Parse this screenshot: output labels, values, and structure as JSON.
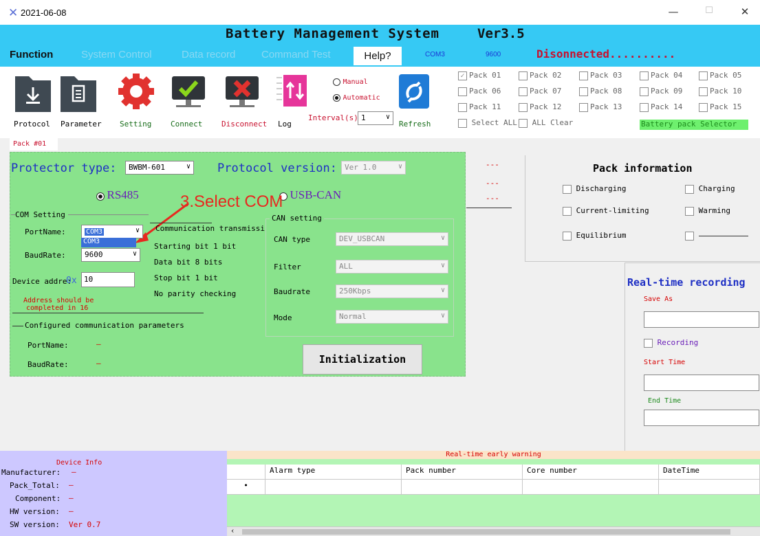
{
  "window": {
    "title": "2021-06-08",
    "minimize": "—",
    "maximize": "☐",
    "close": "✕"
  },
  "header": {
    "title": "Battery Management System",
    "version": "Ver3.5"
  },
  "menu": {
    "items": [
      "Function",
      "System Control",
      "Data record",
      "Command Test",
      "Help?"
    ],
    "com": "COM3",
    "baud": "9600",
    "connection": "Disonnected.........."
  },
  "toolbar": {
    "tools": [
      "Protocol",
      "Parameter",
      "Setting",
      "Connect",
      "Disconnect",
      "Log"
    ],
    "mode_manual": "Manual",
    "mode_automatic": "Automatic",
    "interval_label": "Interval(s)",
    "interval_value": "1",
    "refresh": "Refresh",
    "packs": [
      "Pack 01",
      "Pack 02",
      "Pack 03",
      "Pack 04",
      "Pack 05",
      "Pack 06",
      "Pack 07",
      "Pack 08",
      "Pack 09",
      "Pack 10",
      "Pack 11",
      "Pack 12",
      "Pack 13",
      "Pack 14",
      "Pack 15"
    ],
    "select_all": "Select ALL",
    "all_clear": "ALL Clear",
    "selector_label": "Battery pack Selector"
  },
  "colors": {
    "accent": "#36c9f4",
    "panel": "#89e38c",
    "alert": "#c8102e"
  },
  "tab": {
    "label": "Pack #01"
  },
  "config": {
    "protector_type_label": "Protector type:",
    "protector_type_value": "BWBM-601",
    "protocol_version_label": "Protocol version:",
    "protocol_version_value": "Ver 1.0",
    "rs485": "RS485",
    "usbcan": "USB-CAN",
    "annotation": "3.Select COM",
    "com_setting": "COM Setting",
    "port_name_label": "PortName:",
    "port_name_value": "COM3",
    "port_option": "COM3",
    "baud_rate_label": "BaudRate:",
    "baud_rate_value": "9600",
    "device_addr_label": "Device addre:",
    "device_addr_prefix": "0x",
    "device_addr_value": "10",
    "addr_note_1": "Address should be",
    "addr_note_2": "completed in 16",
    "comm_header": "Communication transmissi",
    "comm_lines": [
      "Starting bit 1 bit",
      "Data bit 8 bits",
      "Stop bit 1 bit",
      "No parity checking"
    ],
    "configured_header": "Configured communication parameters",
    "cfg_port_label": "PortName:",
    "cfg_baud_label": "BaudRate:",
    "dash": "—",
    "can_setting": "CAN setting",
    "can_type_label": "CAN type",
    "can_type_value": "DEV_USBCAN",
    "filter_label": "Filter",
    "filter_value": "ALL",
    "can_baud_label": "Baudrate",
    "can_baud_value": "250Kbps",
    "mode_label": "Mode",
    "mode_value": "Normal",
    "init_button": "Initialization"
  },
  "pack_info": {
    "dashes": [
      "---",
      "---",
      "---"
    ],
    "title": "Pack information",
    "flags": [
      "Discharging",
      "Charging",
      "Current-limiting",
      "Warming",
      "Equilibrium"
    ]
  },
  "recording": {
    "title": "Real-time recording",
    "save_as": "Save As",
    "recording": "Recording",
    "start_time": "Start Time",
    "end_time": "End Time"
  },
  "device_info": {
    "title": "Device Info",
    "rows": [
      {
        "label": "Manufacturer:",
        "value": "—"
      },
      {
        "label": "Pack_Total:",
        "value": "—"
      },
      {
        "label": "Component:",
        "value": "—"
      },
      {
        "label": "HW version:",
        "value": "—"
      },
      {
        "label": "SW version:",
        "value": "Ver 0.7"
      }
    ]
  },
  "warnings": {
    "title": "Real-time early warning",
    "columns": [
      "Alarm type",
      "Pack number",
      "Core number",
      "DateTime"
    ],
    "row_marker": "•"
  }
}
